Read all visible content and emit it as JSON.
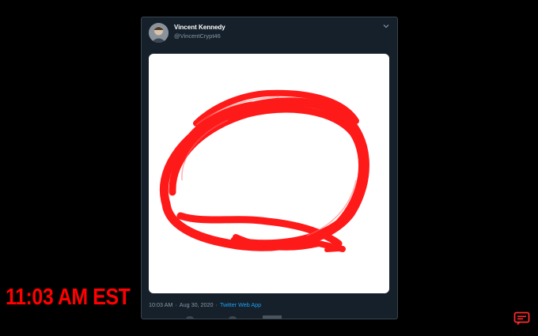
{
  "tweet": {
    "author_name": "Vincent Kennedy",
    "author_handle": "@VincentCrypt46",
    "time": "10:03 AM",
    "date": "Aug 30, 2020",
    "separator": "·",
    "source": "Twitter Web App",
    "media_description": "red coiled tubing on white background"
  },
  "overlay": {
    "clock_text": "11:03 AM EST",
    "clock_color": "#ff0000"
  },
  "icons": {
    "menu": "chevron-down-icon",
    "chat": "chat-icon"
  },
  "colors": {
    "card_bg": "#15202b",
    "link": "#1da1f2",
    "muted_text": "#8899a6",
    "tube": "#ff1a1a"
  }
}
